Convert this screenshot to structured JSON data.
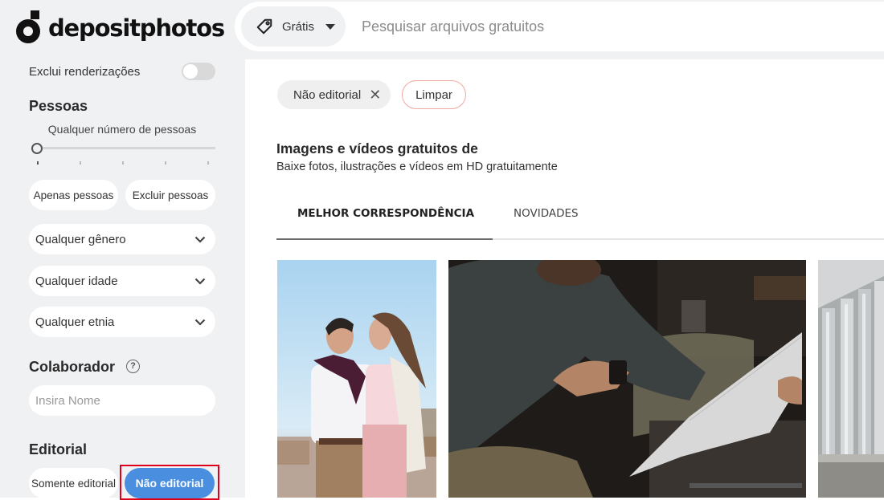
{
  "header": {
    "logo_text": "depositphotos",
    "license_label": "Grátis",
    "search_placeholder": "Pesquisar arquivos gratuitos",
    "search_value": ""
  },
  "sidebar": {
    "exclude_renders": {
      "label": "Exclui renderizações",
      "enabled": false
    },
    "people": {
      "title": "Pessoas",
      "slider_caption": "Qualquer número de pessoas",
      "slider_value": 0,
      "slider_steps": 5,
      "only_people_label": "Apenas pessoas",
      "exclude_people_label": "Excluir pessoas",
      "gender_select": "Qualquer gênero",
      "age_select": "Qualquer idade",
      "ethnicity_select": "Qualquer etnia"
    },
    "contributor": {
      "title": "Colaborador",
      "help_icon": "?",
      "input_placeholder": "Insira Nome",
      "input_value": ""
    },
    "editorial": {
      "title": "Editorial",
      "only_editorial_label": "Somente editorial",
      "non_editorial_label": "Não editorial",
      "selected": "Não editorial",
      "highlight_color": "#e0001b",
      "active_color": "#4a8fdf"
    }
  },
  "main": {
    "active_filters": [
      {
        "label": "Não editorial",
        "remove_icon": "✕"
      }
    ],
    "clear_label": "Limpar",
    "heading": "Imagens e vídeos gratuitos de",
    "subheading": "Baixe fotos, ilustrações e vídeos em HD gratuitamente",
    "tabs": [
      {
        "label": "MELHOR CORRESPONDÊNCIA",
        "active": true
      },
      {
        "label": "NOVIDADES",
        "active": false
      }
    ],
    "results": [
      {
        "description": "Couple embracing outdoors under blue sky"
      },
      {
        "description": "Man in denim shirt reading large paper sheet at dark workbench"
      },
      {
        "description": "White columns of modern building"
      }
    ]
  }
}
